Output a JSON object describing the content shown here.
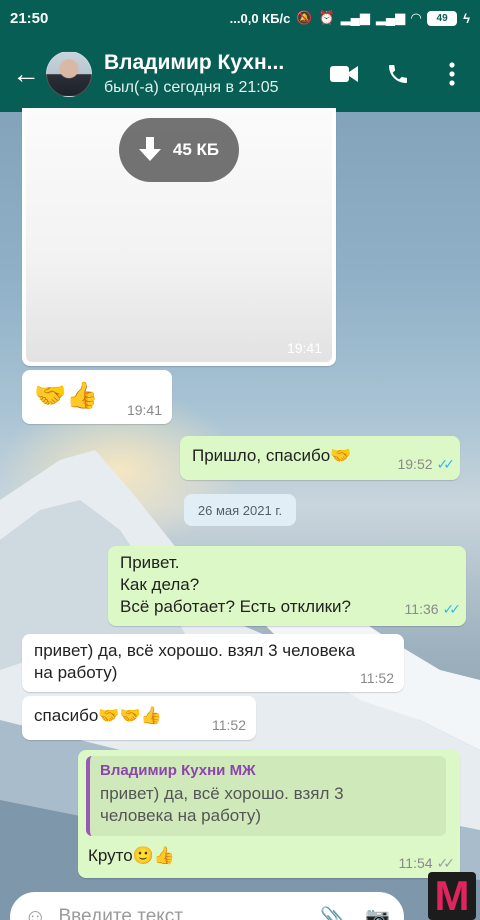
{
  "status_bar": {
    "time": "21:50",
    "network": "...0,0 КБ/с",
    "battery": "49"
  },
  "header": {
    "contact_name": "Владимир Кухн...",
    "last_seen": "был(-а) сегодня в 21:05"
  },
  "messages": [
    {
      "type": "media",
      "size_label": "45 КБ",
      "time": "19:41"
    },
    {
      "type": "in",
      "text": "🤝👍",
      "time": "19:41"
    },
    {
      "type": "out",
      "text": "Пришло, спасибо🤝",
      "time": "19:52",
      "read": true
    },
    {
      "type": "date",
      "text": "26 мая 2021 г."
    },
    {
      "type": "out",
      "text_lines": [
        "Привет.",
        "Как дела?",
        "Всё работает? Есть отклики?"
      ],
      "time": "11:36",
      "read": true
    },
    {
      "type": "in",
      "text_lines": [
        "привет) да, всё хорошо. взял 3 человека",
        "на работу)"
      ],
      "time": "11:52"
    },
    {
      "type": "in",
      "text": "спасибо🤝🤝👍",
      "time": "11:52"
    },
    {
      "type": "out_reply",
      "quote_name": "Владимир Кухни МЖ",
      "quote_lines": [
        "привет) да, всё хорошо. взял 3",
        "человека на работу)"
      ],
      "text": "Круто🙂👍",
      "time": "11:54",
      "read": false
    }
  ],
  "input": {
    "placeholder": "Введите текст"
  },
  "watermark": "M",
  "colors": {
    "header": "#075e54",
    "outgoing_bubble": "#dcf8c6",
    "incoming_bubble": "#ffffff",
    "read_ticks": "#34b7f1"
  }
}
